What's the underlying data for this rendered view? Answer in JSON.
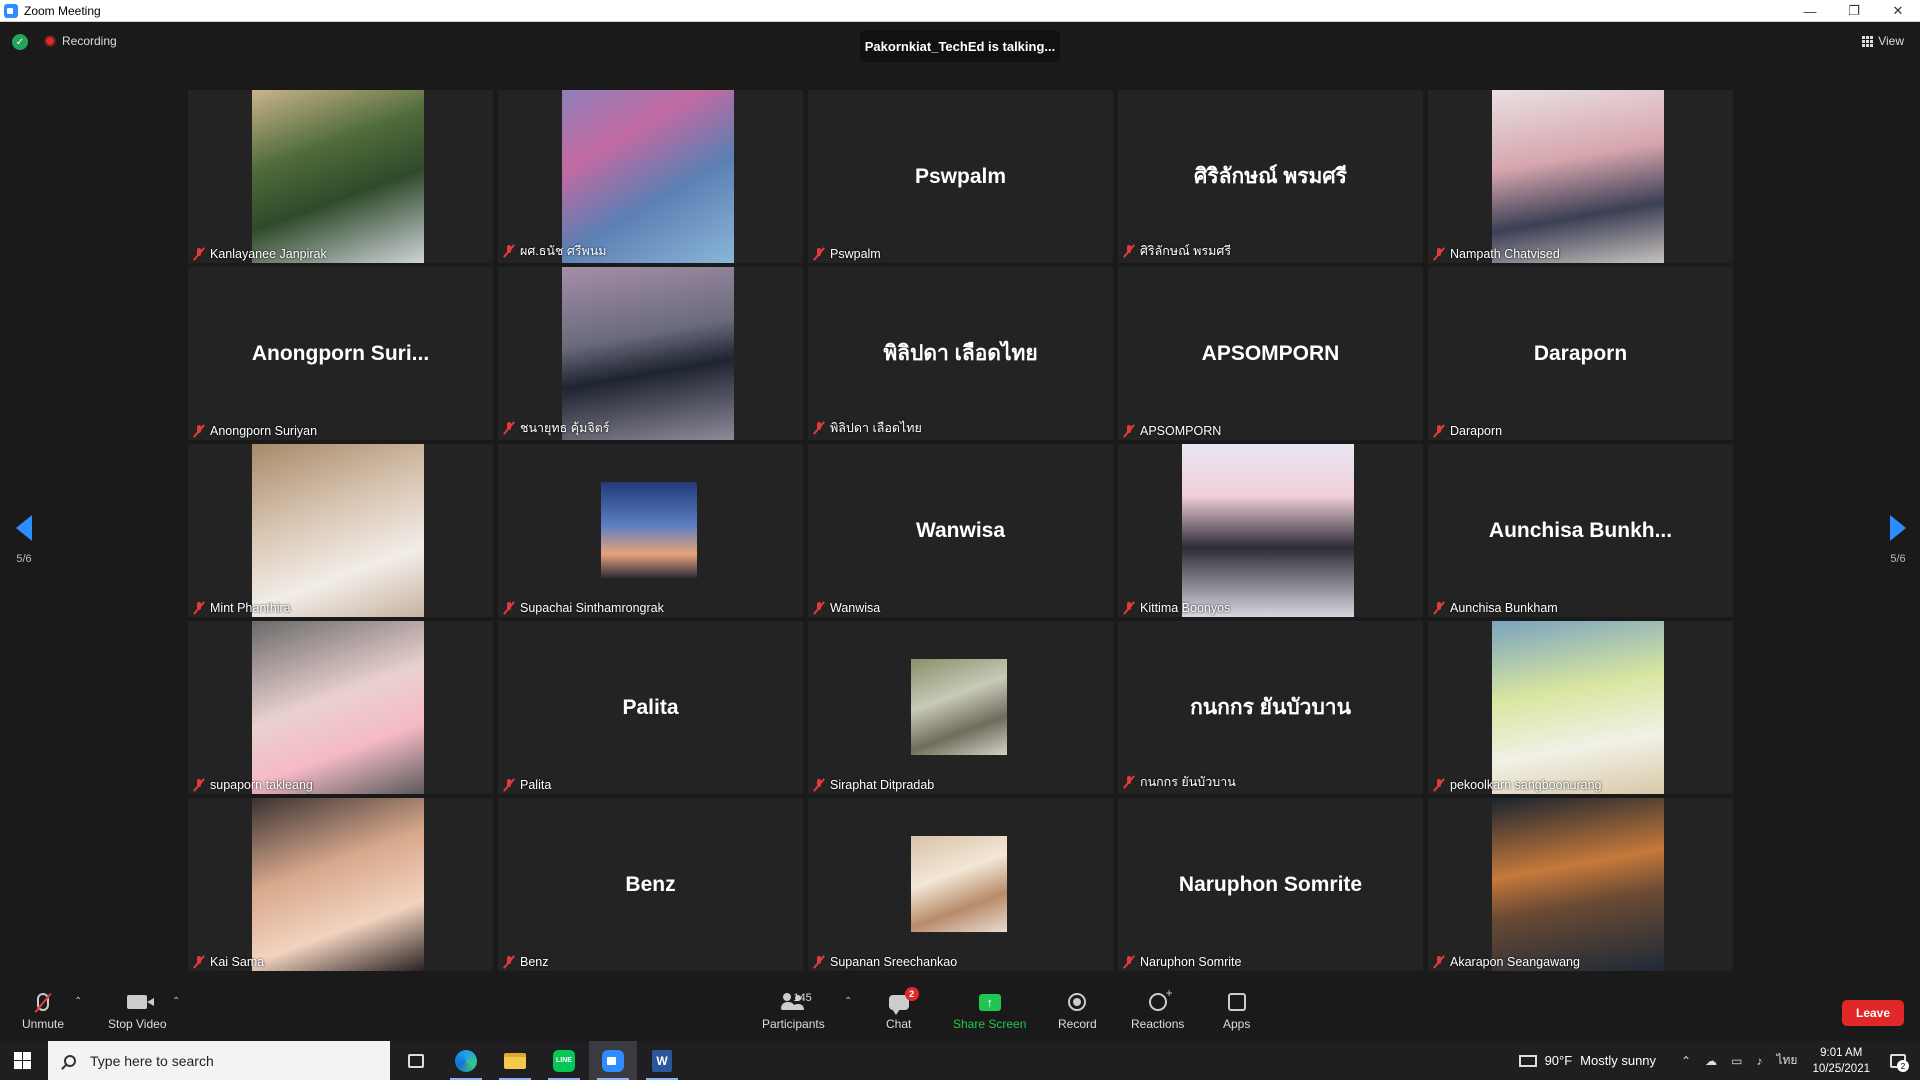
{
  "window": {
    "title": "Zoom Meeting"
  },
  "topbar": {
    "recording_label": "Recording",
    "talking": "Pakornkiat_TechEd is talking...",
    "view_label": "View"
  },
  "participants": [
    {
      "label": "Kanlayanee Janpirak",
      "video": "photo",
      "photo": "ph1"
    },
    {
      "label": "ผศ.ธนัช ศรีพนม",
      "video": "photo",
      "photo": "ph2"
    },
    {
      "label": "Pswpalm",
      "video": "name",
      "display": "Pswpalm"
    },
    {
      "label": "ศิริลักษณ์ พรมศรี",
      "video": "name",
      "display": "ศิริลักษณ์ พรมศรี"
    },
    {
      "label": "Nampath Chatvised",
      "video": "photo",
      "photo": "ph3"
    },
    {
      "label": "Anongporn Suriyan",
      "video": "name",
      "display": "Anongporn Suri..."
    },
    {
      "label": "ชนายุทธ คุ้มจิตร์",
      "video": "photo",
      "photo": "ph4"
    },
    {
      "label": "พิลิปดา เลือดไทย",
      "video": "name",
      "display": "พิลิปดา เลือดไทย"
    },
    {
      "label": "APSOMPORN",
      "video": "name",
      "display": "APSOMPORN"
    },
    {
      "label": "Daraporn",
      "video": "name",
      "display": "Daraporn"
    },
    {
      "label": "Mint Phanthira",
      "video": "photo",
      "photo": "ph5"
    },
    {
      "label": "Supachai Sinthamrongrak",
      "video": "small",
      "photo": "ph6"
    },
    {
      "label": "Wanwisa",
      "video": "name",
      "display": "Wanwisa"
    },
    {
      "label": "Kittima Boonyos",
      "video": "photo",
      "photo": "ph7"
    },
    {
      "label": "Aunchisa Bunkham",
      "video": "name",
      "display": "Aunchisa Bunkh..."
    },
    {
      "label": "supaporn takleang",
      "video": "photo",
      "photo": "ph8"
    },
    {
      "label": "Palita",
      "video": "name",
      "display": "Palita"
    },
    {
      "label": "Siraphat Ditpradab",
      "video": "small",
      "photo": "ph9"
    },
    {
      "label": "กนกกร ยันบัวบาน",
      "video": "name",
      "display": "กนกกร ยันบัวบาน"
    },
    {
      "label": "pekoolkarn sangboonurang",
      "video": "photo",
      "photo": "ph10"
    },
    {
      "label": "Kai Sama",
      "video": "photo",
      "photo": "ph11"
    },
    {
      "label": "Benz",
      "video": "name",
      "display": "Benz"
    },
    {
      "label": "Supanan Sreechankao",
      "video": "small",
      "photo": "ph12"
    },
    {
      "label": "Naruphon Somrite",
      "video": "name",
      "display": "Naruphon Somrite"
    },
    {
      "label": "Akarapon Seangawang",
      "video": "photo",
      "photo": "ph13"
    }
  ],
  "pager": {
    "left": "5/6",
    "right": "5/6"
  },
  "toolbar": {
    "unmute": "Unmute",
    "stop_video": "Stop Video",
    "participants": "Participants",
    "participant_count": "145",
    "chat": "Chat",
    "chat_badge": "2",
    "share_screen": "Share Screen",
    "record": "Record",
    "reactions": "Reactions",
    "apps": "Apps",
    "leave": "Leave"
  },
  "taskbar": {
    "search_placeholder": "Type here to search",
    "temperature": "90°F",
    "weather": "Mostly sunny",
    "language": "ไทย",
    "time": "9:01 AM",
    "date": "10/25/2021",
    "notification_count": "2"
  },
  "colors": {
    "accent": "#2d8cff",
    "leave": "#e02828",
    "share": "#23c552",
    "muted": "#e23b3b"
  }
}
